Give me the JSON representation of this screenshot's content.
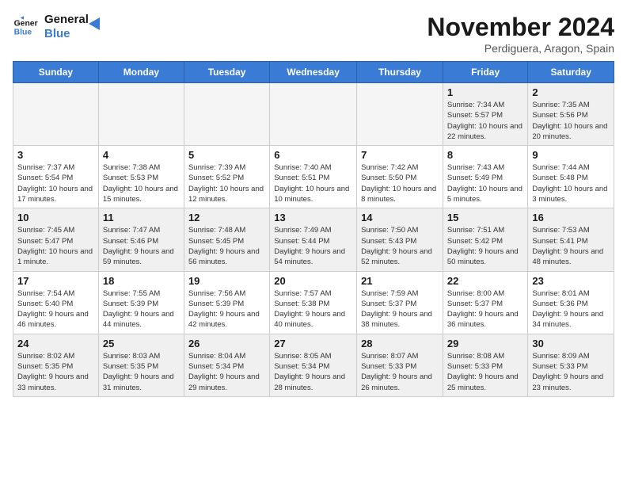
{
  "logo": {
    "line1": "General",
    "line2": "Blue"
  },
  "title": "November 2024",
  "location": "Perdiguera, Aragon, Spain",
  "headers": [
    "Sunday",
    "Monday",
    "Tuesday",
    "Wednesday",
    "Thursday",
    "Friday",
    "Saturday"
  ],
  "rows": [
    [
      {
        "day": "",
        "text": ""
      },
      {
        "day": "",
        "text": ""
      },
      {
        "day": "",
        "text": ""
      },
      {
        "day": "",
        "text": ""
      },
      {
        "day": "",
        "text": ""
      },
      {
        "day": "1",
        "text": "Sunrise: 7:34 AM\nSunset: 5:57 PM\nDaylight: 10 hours and 22 minutes."
      },
      {
        "day": "2",
        "text": "Sunrise: 7:35 AM\nSunset: 5:56 PM\nDaylight: 10 hours and 20 minutes."
      }
    ],
    [
      {
        "day": "3",
        "text": "Sunrise: 7:37 AM\nSunset: 5:54 PM\nDaylight: 10 hours and 17 minutes."
      },
      {
        "day": "4",
        "text": "Sunrise: 7:38 AM\nSunset: 5:53 PM\nDaylight: 10 hours and 15 minutes."
      },
      {
        "day": "5",
        "text": "Sunrise: 7:39 AM\nSunset: 5:52 PM\nDaylight: 10 hours and 12 minutes."
      },
      {
        "day": "6",
        "text": "Sunrise: 7:40 AM\nSunset: 5:51 PM\nDaylight: 10 hours and 10 minutes."
      },
      {
        "day": "7",
        "text": "Sunrise: 7:42 AM\nSunset: 5:50 PM\nDaylight: 10 hours and 8 minutes."
      },
      {
        "day": "8",
        "text": "Sunrise: 7:43 AM\nSunset: 5:49 PM\nDaylight: 10 hours and 5 minutes."
      },
      {
        "day": "9",
        "text": "Sunrise: 7:44 AM\nSunset: 5:48 PM\nDaylight: 10 hours and 3 minutes."
      }
    ],
    [
      {
        "day": "10",
        "text": "Sunrise: 7:45 AM\nSunset: 5:47 PM\nDaylight: 10 hours and 1 minute."
      },
      {
        "day": "11",
        "text": "Sunrise: 7:47 AM\nSunset: 5:46 PM\nDaylight: 9 hours and 59 minutes."
      },
      {
        "day": "12",
        "text": "Sunrise: 7:48 AM\nSunset: 5:45 PM\nDaylight: 9 hours and 56 minutes."
      },
      {
        "day": "13",
        "text": "Sunrise: 7:49 AM\nSunset: 5:44 PM\nDaylight: 9 hours and 54 minutes."
      },
      {
        "day": "14",
        "text": "Sunrise: 7:50 AM\nSunset: 5:43 PM\nDaylight: 9 hours and 52 minutes."
      },
      {
        "day": "15",
        "text": "Sunrise: 7:51 AM\nSunset: 5:42 PM\nDaylight: 9 hours and 50 minutes."
      },
      {
        "day": "16",
        "text": "Sunrise: 7:53 AM\nSunset: 5:41 PM\nDaylight: 9 hours and 48 minutes."
      }
    ],
    [
      {
        "day": "17",
        "text": "Sunrise: 7:54 AM\nSunset: 5:40 PM\nDaylight: 9 hours and 46 minutes."
      },
      {
        "day": "18",
        "text": "Sunrise: 7:55 AM\nSunset: 5:39 PM\nDaylight: 9 hours and 44 minutes."
      },
      {
        "day": "19",
        "text": "Sunrise: 7:56 AM\nSunset: 5:39 PM\nDaylight: 9 hours and 42 minutes."
      },
      {
        "day": "20",
        "text": "Sunrise: 7:57 AM\nSunset: 5:38 PM\nDaylight: 9 hours and 40 minutes."
      },
      {
        "day": "21",
        "text": "Sunrise: 7:59 AM\nSunset: 5:37 PM\nDaylight: 9 hours and 38 minutes."
      },
      {
        "day": "22",
        "text": "Sunrise: 8:00 AM\nSunset: 5:37 PM\nDaylight: 9 hours and 36 minutes."
      },
      {
        "day": "23",
        "text": "Sunrise: 8:01 AM\nSunset: 5:36 PM\nDaylight: 9 hours and 34 minutes."
      }
    ],
    [
      {
        "day": "24",
        "text": "Sunrise: 8:02 AM\nSunset: 5:35 PM\nDaylight: 9 hours and 33 minutes."
      },
      {
        "day": "25",
        "text": "Sunrise: 8:03 AM\nSunset: 5:35 PM\nDaylight: 9 hours and 31 minutes."
      },
      {
        "day": "26",
        "text": "Sunrise: 8:04 AM\nSunset: 5:34 PM\nDaylight: 9 hours and 29 minutes."
      },
      {
        "day": "27",
        "text": "Sunrise: 8:05 AM\nSunset: 5:34 PM\nDaylight: 9 hours and 28 minutes."
      },
      {
        "day": "28",
        "text": "Sunrise: 8:07 AM\nSunset: 5:33 PM\nDaylight: 9 hours and 26 minutes."
      },
      {
        "day": "29",
        "text": "Sunrise: 8:08 AM\nSunset: 5:33 PM\nDaylight: 9 hours and 25 minutes."
      },
      {
        "day": "30",
        "text": "Sunrise: 8:09 AM\nSunset: 5:33 PM\nDaylight: 9 hours and 23 minutes."
      }
    ]
  ]
}
